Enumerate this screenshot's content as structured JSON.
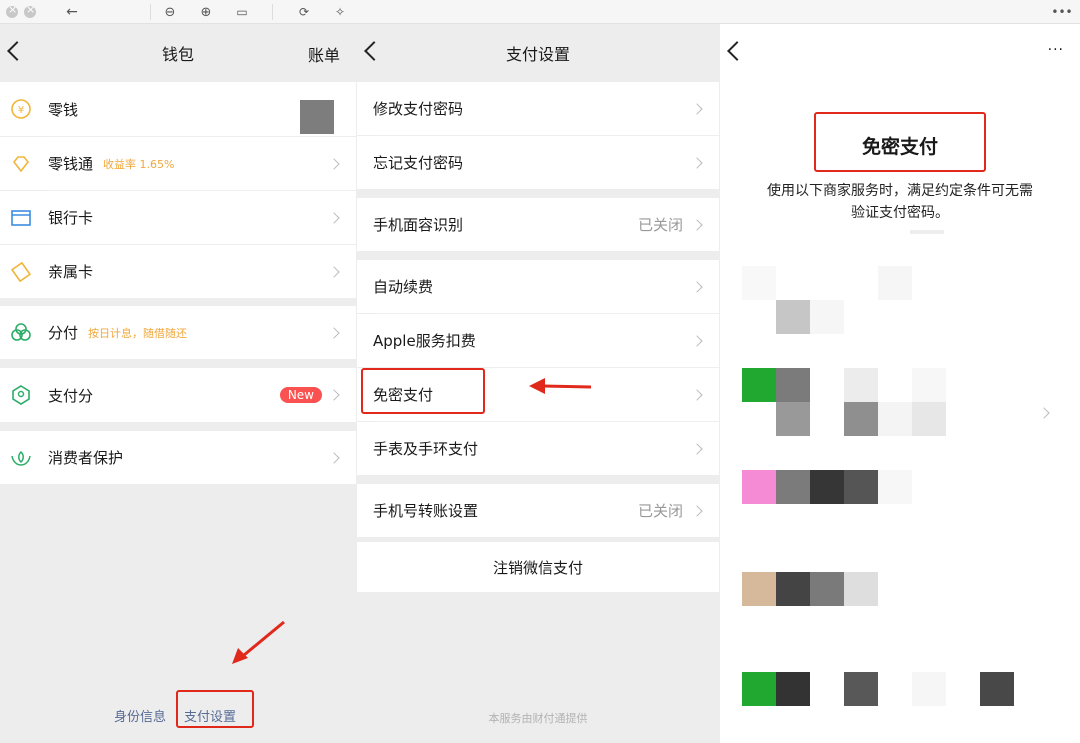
{
  "wallet": {
    "title": "钱包",
    "bill": "账单",
    "items": [
      {
        "label": "零钱"
      },
      {
        "label": "零钱通",
        "sub": "收益率 1.65%"
      },
      {
        "label": "银行卡"
      },
      {
        "label": "亲属卡"
      },
      {
        "label": "分付",
        "sub": "按日计息，随借随还"
      },
      {
        "label": "支付分",
        "badge": "New"
      },
      {
        "label": "消费者保护"
      }
    ],
    "footer": {
      "identity": "身份信息",
      "settings": "支付设置"
    }
  },
  "settings": {
    "title": "支付设置",
    "items": [
      {
        "label": "修改支付密码"
      },
      {
        "label": "忘记支付密码"
      },
      {
        "label": "手机面容识别",
        "value": "已关闭"
      },
      {
        "label": "自动续费"
      },
      {
        "label": "Apple服务扣费"
      },
      {
        "label": "免密支付"
      },
      {
        "label": "手表及手环支付"
      },
      {
        "label": "手机号转账设置",
        "value": "已关闭"
      }
    ],
    "cancel": "注销微信支付",
    "footnote": "本服务由财付通提供"
  },
  "nopass": {
    "title": "免密支付",
    "desc1": "使用以下商家服务时，满足约定条件可无需",
    "desc2": "验证支付密码。",
    "more": "···"
  },
  "colors": {
    "accent_red": "#e0291b",
    "link": "#576b95",
    "badge": "#fa5151",
    "sub": "#f0a83c"
  }
}
